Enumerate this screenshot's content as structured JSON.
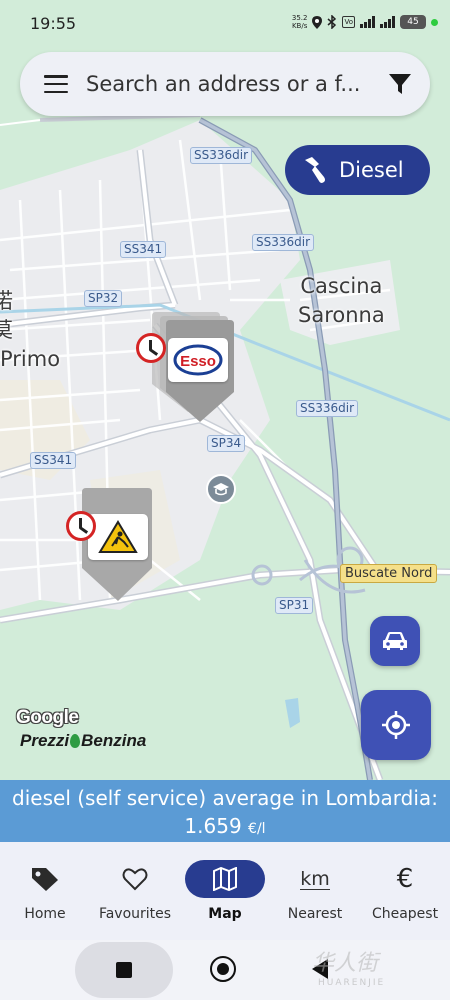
{
  "status_bar": {
    "time": "19:55",
    "net_speed_value": "35.2",
    "net_speed_unit": "KB/s",
    "battery": "45"
  },
  "search": {
    "placeholder": "Search an address or a f..."
  },
  "fuel_filter": {
    "label": "Diesel"
  },
  "map": {
    "roads": {
      "ss336dir_1": "SS336dir",
      "ss336dir_2": "SS336dir",
      "ss336dir_3": "SS336dir",
      "ss341_1": "SS341",
      "ss341_2": "SS341",
      "sp32": "SP32",
      "sp34": "SP34",
      "sp31": "SP31",
      "buscate_nord": "Buscate Nord"
    },
    "places": {
      "cascina_line1": "Cascina",
      "cascina_line2": "Saronna",
      "left_line1": "诺",
      "left_line2": "莫",
      "left_line3": "Primo"
    },
    "markers": [
      {
        "brand": "Esso",
        "type": "fuel-station",
        "has_clock": true
      },
      {
        "brand": "",
        "type": "roadworks-station",
        "has_clock": true
      }
    ],
    "attribution_google": "Google",
    "brand_name_part1": "Prezzi",
    "brand_name_part2": "Benzina"
  },
  "average_banner": {
    "line1": "diesel (self service) average in Lombardia:",
    "price": "1.659",
    "unit": "€/l"
  },
  "bottom_nav": {
    "items": [
      {
        "label": "Home",
        "icon": "tag-icon"
      },
      {
        "label": "Favourites",
        "icon": "heart-icon"
      },
      {
        "label": "Map",
        "icon": "map-icon",
        "active": true
      },
      {
        "label": "Nearest",
        "icon": "km-icon",
        "icon_text": "km"
      },
      {
        "label": "Cheapest",
        "icon": "euro-icon",
        "icon_text": "€"
      }
    ]
  },
  "watermark": {
    "text": "华人街",
    "subtext": "HUARENJIE"
  },
  "colors": {
    "accent": "#283c90",
    "fab": "#3f51b5",
    "banner": "#5b9bd5",
    "map_green": "#cfe8d4"
  }
}
